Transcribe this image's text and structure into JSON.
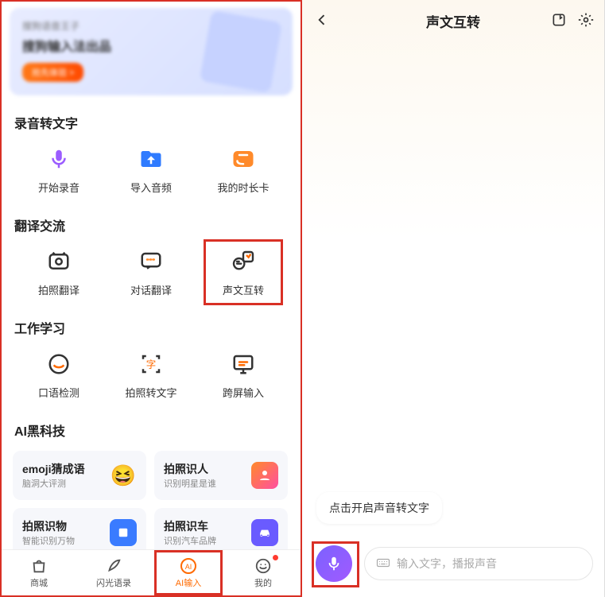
{
  "banner": {
    "subtitle": "搜狗语音王子",
    "title": "搜狗输入法出品",
    "button": "抢先体验 >"
  },
  "sections": {
    "record": {
      "title": "录音转文字",
      "items": [
        "开始录音",
        "导入音频",
        "我的时长卡"
      ]
    },
    "translate": {
      "title": "翻译交流",
      "items": [
        "拍照翻译",
        "对话翻译",
        "声文互转"
      ]
    },
    "work": {
      "title": "工作学习",
      "items": [
        "口语检测",
        "拍照转文字",
        "跨屏输入"
      ]
    },
    "ai": {
      "title": "AI黑科技",
      "cards": [
        {
          "title": "emoji猜成语",
          "sub": "脑洞大评测"
        },
        {
          "title": "拍照识人",
          "sub": "识别明星是谁"
        },
        {
          "title": "拍照识物",
          "sub": "智能识别万物"
        },
        {
          "title": "拍照识车",
          "sub": "识别汽车品牌"
        }
      ]
    }
  },
  "tabs": [
    "商城",
    "闪光语录",
    "AI输入",
    "我的"
  ],
  "right": {
    "title": "声文互转",
    "bubble": "点击开启声音转文字",
    "placeholder": "输入文字，播报声音"
  },
  "colors": {
    "highlight": "#d93025",
    "accent": "#ff6a00",
    "mic": "#7b61ff"
  }
}
